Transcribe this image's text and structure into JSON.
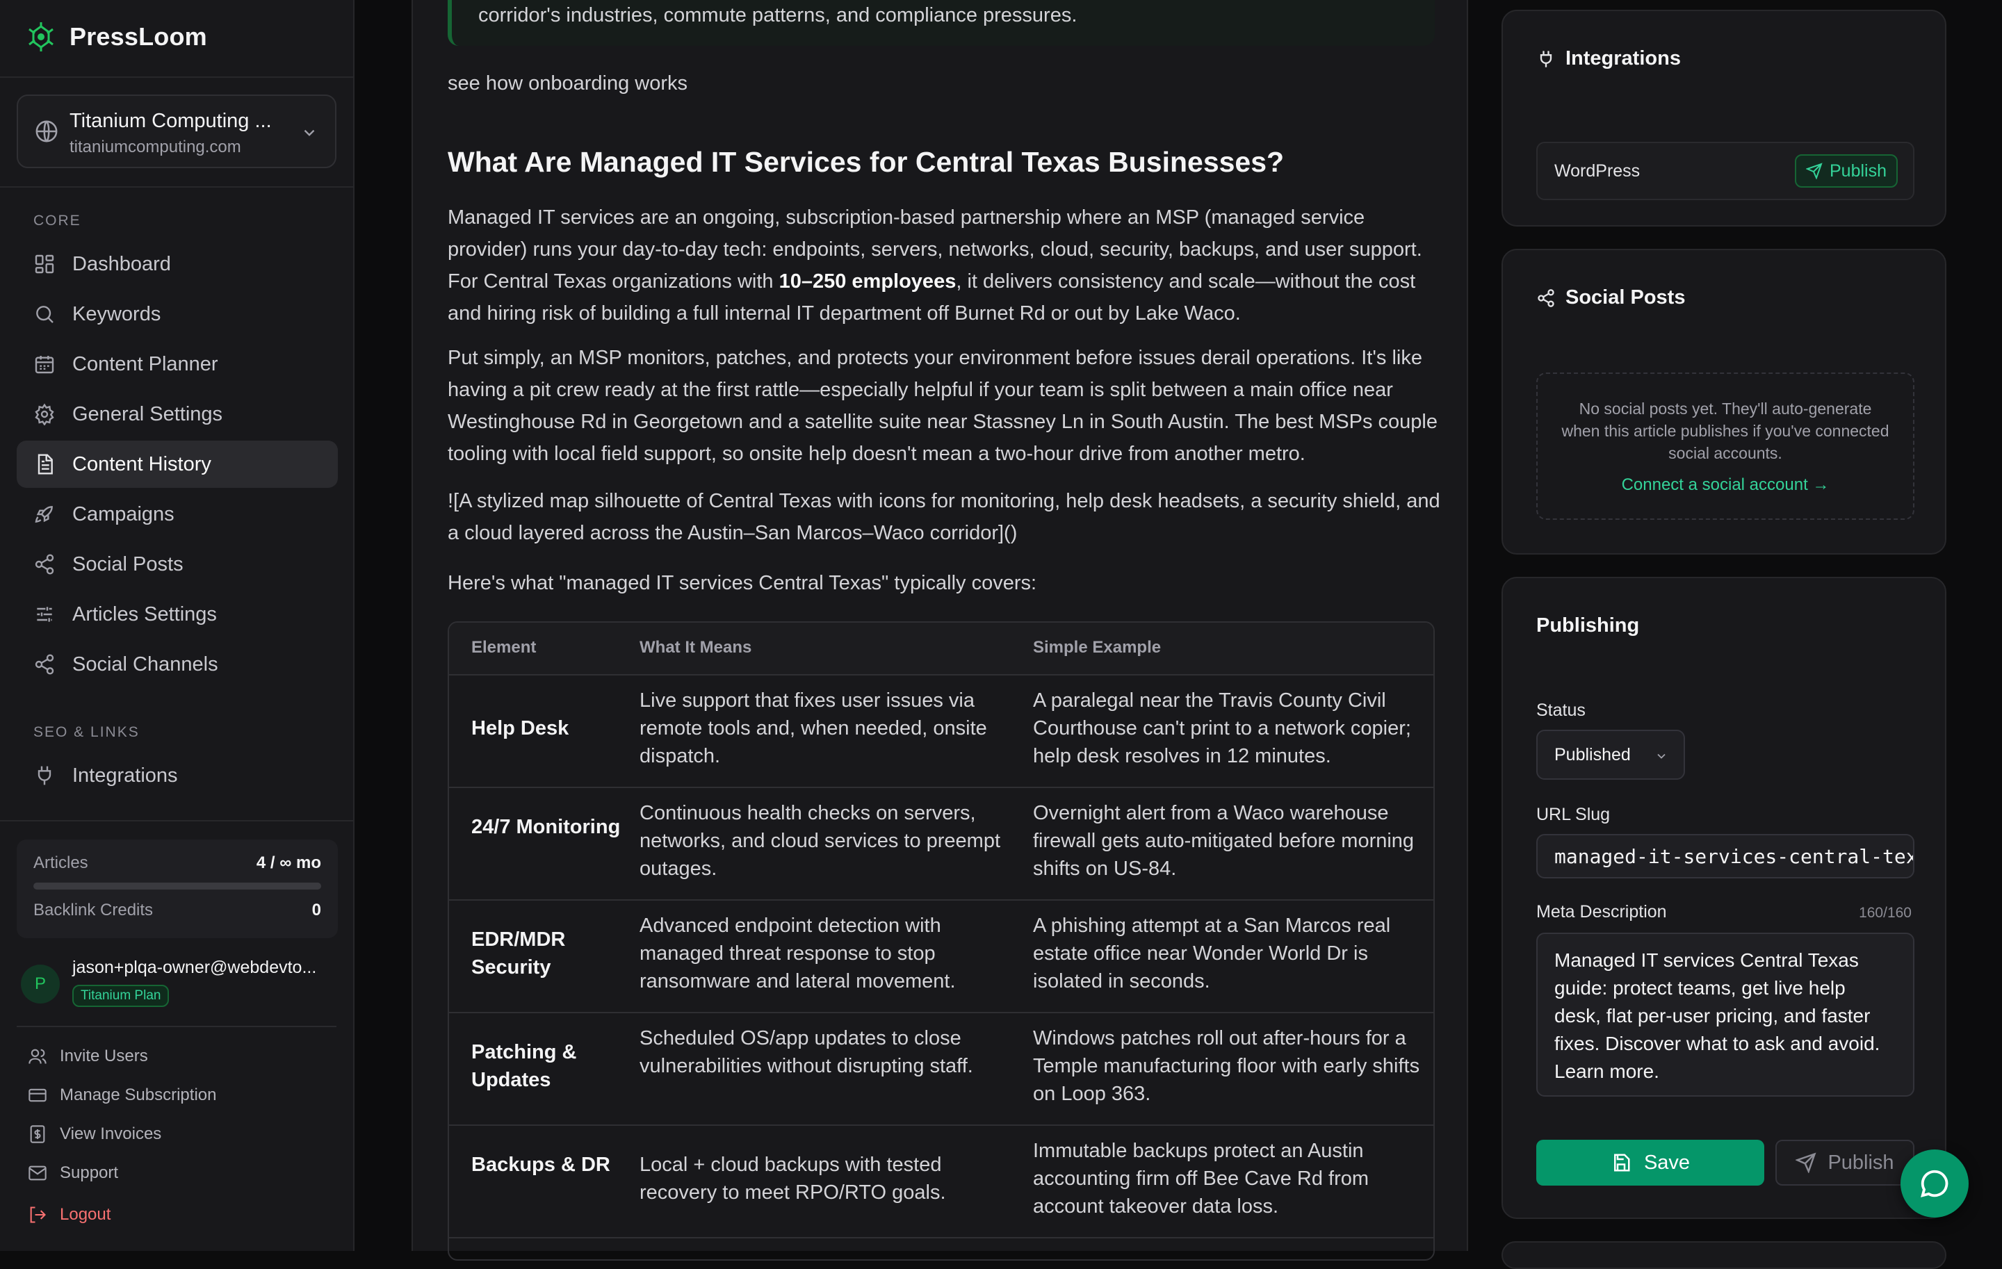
{
  "brand": {
    "name": "PressLoom",
    "accent": "#22c55e"
  },
  "site": {
    "name": "Titanium Computing ...",
    "domain": "titaniumcomputing.com"
  },
  "nav": {
    "core_label": "CORE",
    "seo_label": "SEO & LINKS",
    "items": [
      {
        "label": "Dashboard",
        "icon": "dashboard-icon"
      },
      {
        "label": "Keywords",
        "icon": "search-icon"
      },
      {
        "label": "Content Planner",
        "icon": "calendar-icon"
      },
      {
        "label": "General Settings",
        "icon": "gear-icon"
      },
      {
        "label": "Content History",
        "icon": "document-icon",
        "active": true
      },
      {
        "label": "Campaigns",
        "icon": "rocket-icon"
      },
      {
        "label": "Social Posts",
        "icon": "share-icon"
      },
      {
        "label": "Articles Settings",
        "icon": "sliders-icon"
      },
      {
        "label": "Social Channels",
        "icon": "share-icon"
      }
    ],
    "seo_items": [
      {
        "label": "Integrations",
        "icon": "plug-icon"
      }
    ]
  },
  "usage": {
    "articles_label": "Articles",
    "articles_value": "4 / ∞ mo",
    "credits_label": "Backlink Credits",
    "credits_value": "0"
  },
  "user": {
    "initial": "P",
    "email": "jason+plqa-owner@webdevto...",
    "plan": "Titanium Plan"
  },
  "footer_links": {
    "invite": "Invite Users",
    "subscription": "Manage Subscription",
    "invoices": "View Invoices",
    "support": "Support",
    "logout": "Logout"
  },
  "article": {
    "quote_tail": "corridor's industries, commute patterns, and compliance pressures.",
    "onboarding_link": "see how onboarding works",
    "heading": "What Are Managed IT Services for Central Texas Businesses?",
    "p1_a": "Managed IT services are an ongoing, subscription-based partnership where an MSP (managed service provider) runs your day-to-day tech: endpoints, servers, networks, cloud, security, backups, and user support. For Central Texas organizations with ",
    "p1_bold": "10–250 employees",
    "p1_b": ", it delivers consistency and scale—without the cost and hiring risk of building a full internal IT department off Burnet Rd or out by Lake Waco.",
    "p2": "Put simply, an MSP monitors, patches, and protects your environment before issues derail operations. It's like having a pit crew ready at the first rattle—especially helpful if your team is split between a main office near Westinghouse Rd in Georgetown and a satellite suite near Stassney Ln in South Austin. The best MSPs couple tooling with local field support, so onsite help doesn't mean a two-hour drive from another metro.",
    "p3": "![A stylized map silhouette of Central Texas with icons for monitoring, help desk headsets, a security shield, and a cloud layered across the Austin–San Marcos–Waco corridor]()",
    "p4": "Here's what \"managed IT services Central Texas\" typically covers:",
    "table": {
      "headers": [
        "Element",
        "What It Means",
        "Simple Example"
      ],
      "rows": [
        [
          "Help Desk",
          "Live support that fixes user issues via remote tools and, when needed, onsite dispatch.",
          "A paralegal near the Travis County Civil Courthouse can't print to a network copier; help desk resolves in 12 minutes."
        ],
        [
          "24/7 Monitoring",
          "Continuous health checks on servers, networks, and cloud services to preempt outages.",
          "Overnight alert from a Waco warehouse firewall gets auto-mitigated before morning shifts on US-84."
        ],
        [
          "EDR/MDR Security",
          "Advanced endpoint detection with managed threat response to stop ransomware and lateral movement.",
          "A phishing attempt at a San Marcos real estate office near Wonder World Dr is isolated in seconds."
        ],
        [
          "Patching & Updates",
          "Scheduled OS/app updates to close vulnerabilities without disrupting staff.",
          "Windows patches roll out after-hours for a Temple manufacturing floor with early shifts on Loop 363."
        ],
        [
          "Backups & DR",
          "Local + cloud backups with tested recovery to meet RPO/RTO goals.",
          "Immutable backups protect an Austin accounting firm off Bee Cave Rd from account takeover data loss."
        ]
      ]
    }
  },
  "integrations": {
    "title": "Integrations",
    "item_name": "WordPress",
    "publish_label": "Publish"
  },
  "social": {
    "title": "Social Posts",
    "empty_text": "No social posts yet. They'll auto-generate when this article publishes if you've connected social accounts.",
    "connect_link": "Connect a social account →"
  },
  "publishing": {
    "title": "Publishing",
    "status_label": "Status",
    "status_value": "Published",
    "slug_label": "URL Slug",
    "slug_value": "managed-it-services-central-texas",
    "meta_label": "Meta Description",
    "meta_counter": "160/160",
    "meta_value": "Managed IT services Central Texas guide: protect teams, get live help desk, flat per-user pricing, and faster fixes. Discover what to ask and avoid. Learn more.",
    "save_label": "Save",
    "publish_label": "Publish"
  }
}
